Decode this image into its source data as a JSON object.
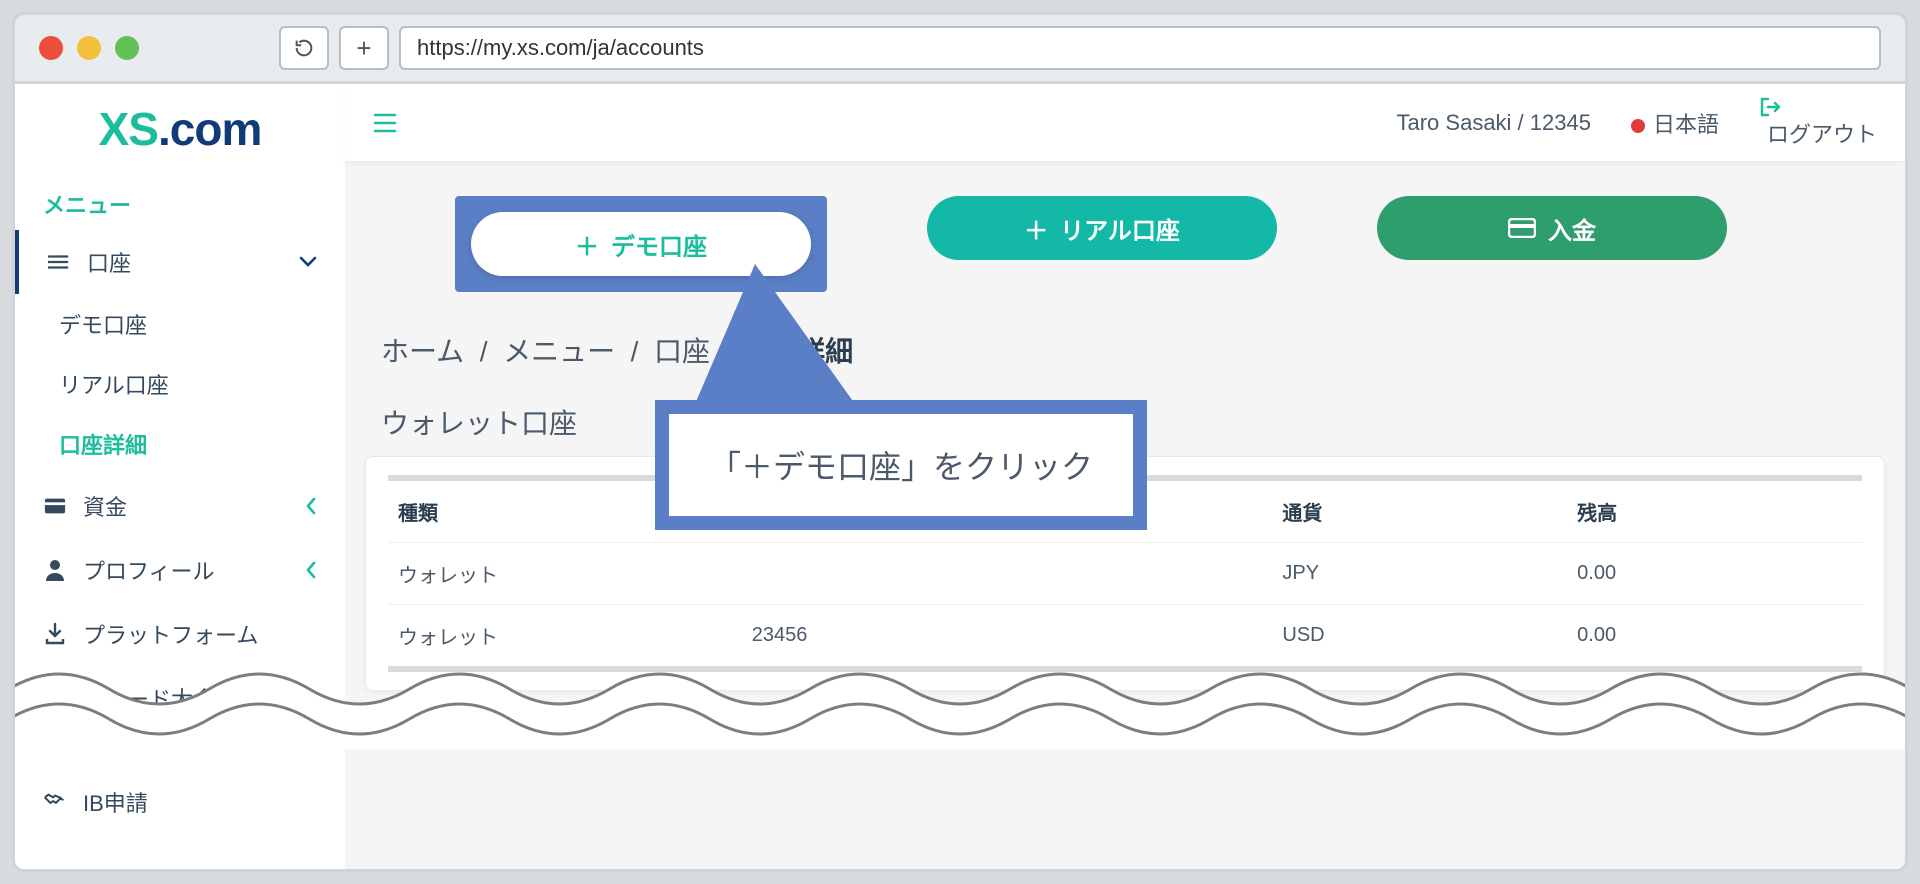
{
  "browser": {
    "url": "https://my.xs.com/ja/accounts"
  },
  "logo": {
    "text_a": "XS",
    "text_b": ".com"
  },
  "sidebar": {
    "menu_title": "メニュー",
    "items": [
      {
        "label": "口座",
        "icon": "list-icon",
        "expanded": true
      },
      {
        "label": "デモ口座"
      },
      {
        "label": "リアル口座"
      },
      {
        "label": "口座詳細",
        "active": true
      },
      {
        "label": "資金",
        "icon": "wallet-icon",
        "collapsible": true
      },
      {
        "label": "プロフィール",
        "icon": "user-icon",
        "collapsible": true
      },
      {
        "label": "プラットフォーム",
        "icon": "download-icon"
      },
      {
        "label": "トレード大会",
        "icon": "trophy-icon"
      },
      {
        "label": "IB申請",
        "icon": "handshake-icon"
      }
    ]
  },
  "topbar": {
    "user": "Taro Sasaki / 12345",
    "language": "日本語",
    "logout": "ログアウト"
  },
  "actions": {
    "demo": "デモ口座",
    "real": "リアル口座",
    "deposit": "入金"
  },
  "breadcrumb": {
    "home": "ホーム",
    "menu": "メニュー",
    "accounts": "口座",
    "current": "口座詳細"
  },
  "section_title": "ウォレット口座",
  "table": {
    "headers": {
      "type": "種類",
      "number": "",
      "currency": "通貨",
      "balance": "残高"
    },
    "rows": [
      {
        "type": "ウォレット",
        "number": "",
        "currency": "JPY",
        "balance": "0.00"
      },
      {
        "type": "ウォレット",
        "number": "23456",
        "currency": "USD",
        "balance": "0.00"
      }
    ]
  },
  "callout": "「＋デモ口座」をクリック"
}
